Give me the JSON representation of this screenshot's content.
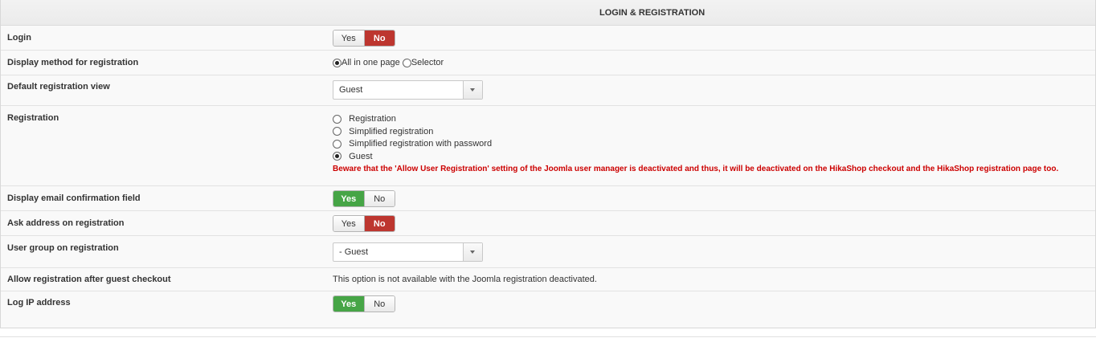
{
  "section": {
    "title": "LOGIN & REGISTRATION"
  },
  "login": {
    "label": "Login",
    "yes": "Yes",
    "no": "No",
    "selected": "No"
  },
  "display_method": {
    "label": "Display method for registration",
    "options": [
      "All in one page",
      "Selector"
    ],
    "selected": "All in one page"
  },
  "default_view": {
    "label": "Default registration view",
    "value": "Guest"
  },
  "registration": {
    "label": "Registration",
    "options": [
      "Registration",
      "Simplified registration",
      "Simplified registration with password",
      "Guest"
    ],
    "selected": "Guest",
    "warning": "Beware that the 'Allow User Registration' setting of the Joomla user manager is deactivated and thus, it will be deactivated on the HikaShop checkout and the HikaShop registration page too."
  },
  "email_confirm": {
    "label": "Display email confirmation field",
    "yes": "Yes",
    "no": "No",
    "selected": "Yes"
  },
  "ask_address": {
    "label": "Ask address on registration",
    "yes": "Yes",
    "no": "No",
    "selected": "No"
  },
  "user_group": {
    "label": "User group on registration",
    "value": "- Guest"
  },
  "allow_after_guest": {
    "label": "Allow registration after guest checkout",
    "note": "This option is not available with the Joomla registration deactivated."
  },
  "log_ip": {
    "label": "Log IP address",
    "yes": "Yes",
    "no": "No",
    "selected": "Yes"
  },
  "colors": {
    "no_active": "#bd362f",
    "yes_active": "#46a546",
    "warning": "#cc0000"
  }
}
